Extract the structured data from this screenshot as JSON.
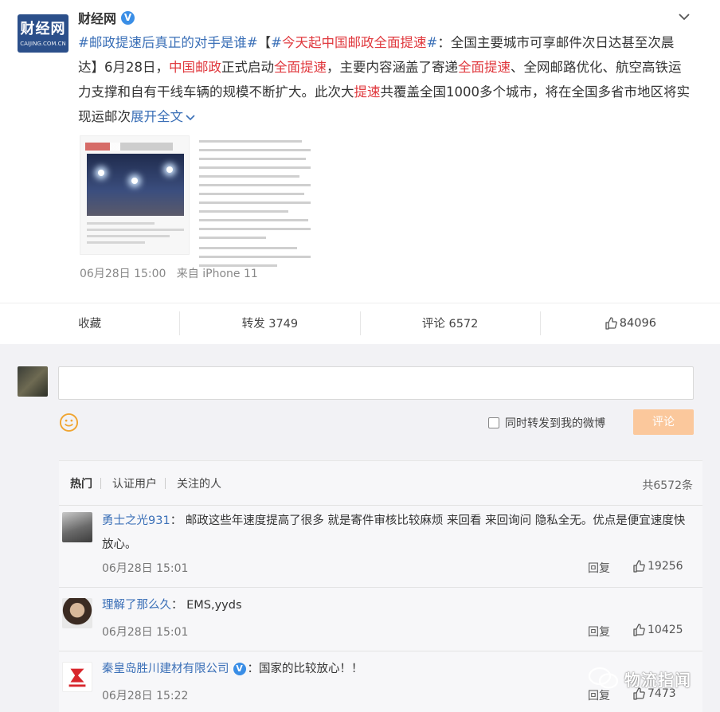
{
  "post": {
    "author": "财经网",
    "avatar_logo": "财经网",
    "avatar_sub": "CAIJING.COM.CN",
    "text_segments": [
      {
        "t": "#邮政提速后真正的对手是谁#",
        "c": "hl-blue"
      },
      {
        "t": "【",
        "c": ""
      },
      {
        "t": "#今天起中国邮政全面提速#",
        "c": "hl-blue-red"
      },
      {
        "t": "：全国主要城市可享邮件次日达甚至次晨达】6月28日，",
        "c": ""
      },
      {
        "t": "中国邮政",
        "c": "hl-red"
      },
      {
        "t": "正式启动",
        "c": ""
      },
      {
        "t": "全面提速",
        "c": "hl-red"
      },
      {
        "t": "，主要内容涵盖了寄递",
        "c": ""
      },
      {
        "t": "全面提速",
        "c": "hl-red"
      },
      {
        "t": "、全网邮路优化、航空高铁运力支撑和自有干线车辆的规模不断扩大。此次大",
        "c": ""
      },
      {
        "t": "提速",
        "c": "hl-red"
      },
      {
        "t": "共覆盖全国1000多个城市，将在全国多省市地区将实现运邮次",
        "c": ""
      }
    ],
    "hashtag2": {
      "prefix": "#",
      "red": "今天起中国邮政全面提速",
      "suffix": "#"
    },
    "expand_label": "展开全文",
    "meta_time": "06月28日 15:00",
    "meta_source": "来自 iPhone 11"
  },
  "actions": {
    "collect": "收藏",
    "forward": "转发 3749",
    "comment": "评论 6572",
    "like": "84096"
  },
  "composer": {
    "forward_label": "同时转发到我的微博",
    "submit_label": "评论"
  },
  "filters": {
    "hot": "热门",
    "verified": "认证用户",
    "following": "关注的人",
    "total": "共6572条"
  },
  "comments": [
    {
      "name": "勇士之光931",
      "sep": "：",
      "text": "邮政这些年速度提高了很多 就是寄件审核比较麻烦 来回看 来回询问 隐私全无。优点是便宜速度快 放心。",
      "time": "06月28日 15:01",
      "reply": "回复",
      "likes": "19256"
    },
    {
      "name": "理解了那么久",
      "sep": "：",
      "text": "EMS,yyds",
      "time": "06月28日 15:01",
      "reply": "回复",
      "likes": "10425"
    },
    {
      "name": "秦皇岛胜川建材有限公司",
      "sep": "：",
      "text": "国家的比较放心！！",
      "time": "06月28日 15:22",
      "reply": "回复",
      "likes": "7473"
    }
  ],
  "watermark": "物流指闻",
  "colors": {
    "link": "#3a6fb7",
    "highlight": "#e0393e",
    "submit": "#fbc89c",
    "verified": "#3a8ee6"
  }
}
